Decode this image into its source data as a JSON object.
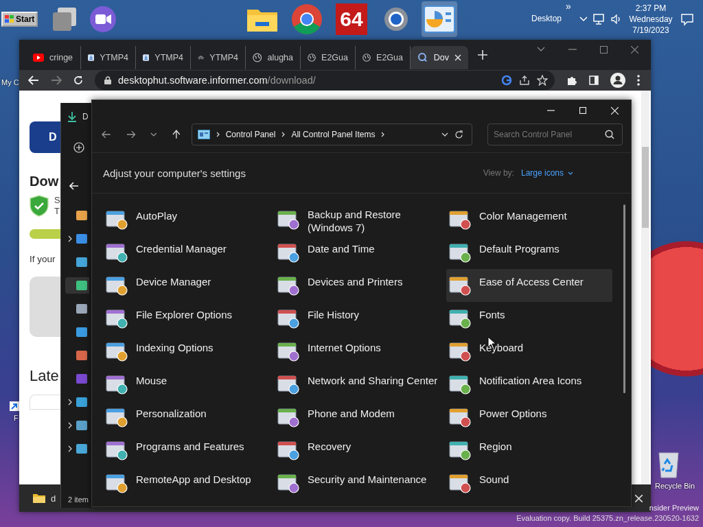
{
  "taskbar": {
    "start_label": "Start",
    "pinned": [
      {
        "kind": "window",
        "selected": false
      },
      {
        "kind": "video",
        "selected": false
      },
      {
        "kind": "folder",
        "selected": false
      },
      {
        "kind": "chrome",
        "selected": false
      },
      {
        "kind": "badge",
        "label": "64",
        "selected": false
      },
      {
        "kind": "gear",
        "selected": false
      },
      {
        "kind": "chart",
        "selected": true
      }
    ],
    "tray_overflow": "»",
    "toolbar_label": "Desktop",
    "time": "2:37 PM",
    "day": "Wednesday",
    "date": "7/19/2023"
  },
  "desktop_icons": [
    {
      "kind": "computer",
      "label": "My C"
    },
    {
      "kind": "shortcut",
      "label": "F"
    },
    {
      "kind": "bin",
      "label": "Recycle Bin"
    }
  ],
  "build_info": [
    "nsider Preview",
    "Evaluation copy. Build 25375.zn_release.230520-1632"
  ],
  "browser": {
    "tabs": [
      {
        "kind": "youtube",
        "title": "cringe",
        "selected": false
      },
      {
        "kind": "download",
        "title": "YTMP4",
        "selected": false
      },
      {
        "kind": "download",
        "title": "YTMP4",
        "selected": false
      },
      {
        "kind": "cap",
        "title": "YTMP4",
        "selected": false
      },
      {
        "kind": "globe",
        "title": "alugha",
        "selected": false
      },
      {
        "kind": "globe",
        "title": "E2Gua",
        "selected": false
      },
      {
        "kind": "globe",
        "title": "E2Gua",
        "selected": false
      },
      {
        "kind": "search",
        "title": "Dov",
        "selected": true
      }
    ],
    "url_host": "desktophut.software.informer.com",
    "url_path": "/download/",
    "page": {
      "button": "D",
      "heading": "Dow",
      "badge_lines": [
        "S",
        "T"
      ],
      "text": "If your",
      "section": "Late"
    },
    "download_shelf": {
      "file": "d"
    }
  },
  "file_explorer": {
    "header": "D",
    "nav": [
      {
        "kind": "home",
        "selected": false
      },
      {
        "kind": "cloud",
        "expandable": true,
        "selected": false
      },
      {
        "kind": "desktop",
        "selected": false
      },
      {
        "kind": "download",
        "selected": true
      },
      {
        "kind": "document",
        "selected": false
      },
      {
        "kind": "picture",
        "selected": false
      },
      {
        "kind": "music",
        "selected": false
      },
      {
        "kind": "video",
        "selected": false
      },
      {
        "kind": "computer",
        "expandable": true,
        "selected": false
      },
      {
        "kind": "drive",
        "expandable": true,
        "selected": false
      },
      {
        "kind": "network",
        "expandable": true,
        "selected": false
      }
    ],
    "status": "2 item"
  },
  "control_panel": {
    "breadcrumb": [
      "Control Panel",
      "All Control Panel Items"
    ],
    "search_placeholder": "Search Control Panel",
    "heading": "Adjust your computer's settings",
    "view_by_label": "View by:",
    "view_by_value": "Large icons",
    "items": [
      {
        "label": "AutoPlay",
        "selected": false
      },
      {
        "label": "Backup and Restore (Windows 7)",
        "selected": false
      },
      {
        "label": "Color Management",
        "selected": false
      },
      {
        "label": "Credential Manager",
        "selected": false
      },
      {
        "label": "Date and Time",
        "selected": false
      },
      {
        "label": "Default Programs",
        "selected": false
      },
      {
        "label": "Device Manager",
        "selected": false
      },
      {
        "label": "Devices and Printers",
        "selected": false
      },
      {
        "label": "Ease of Access Center",
        "selected": true
      },
      {
        "label": "File Explorer Options",
        "selected": false
      },
      {
        "label": "File History",
        "selected": false
      },
      {
        "label": "Fonts",
        "selected": false
      },
      {
        "label": "Indexing Options",
        "selected": false
      },
      {
        "label": "Internet Options",
        "selected": false
      },
      {
        "label": "Keyboard",
        "selected": false
      },
      {
        "label": "Mouse",
        "selected": false
      },
      {
        "label": "Network and Sharing Center",
        "selected": false
      },
      {
        "label": "Notification Area Icons",
        "selected": false
      },
      {
        "label": "Personalization",
        "selected": false
      },
      {
        "label": "Phone and Modem",
        "selected": false
      },
      {
        "label": "Power Options",
        "selected": false
      },
      {
        "label": "Programs and Features",
        "selected": false
      },
      {
        "label": "Recovery",
        "selected": false
      },
      {
        "label": "Region",
        "selected": false
      },
      {
        "label": "RemoteApp and Desktop",
        "selected": false
      },
      {
        "label": "Security and Maintenance",
        "selected": false
      },
      {
        "label": "Sound",
        "selected": false
      }
    ]
  }
}
